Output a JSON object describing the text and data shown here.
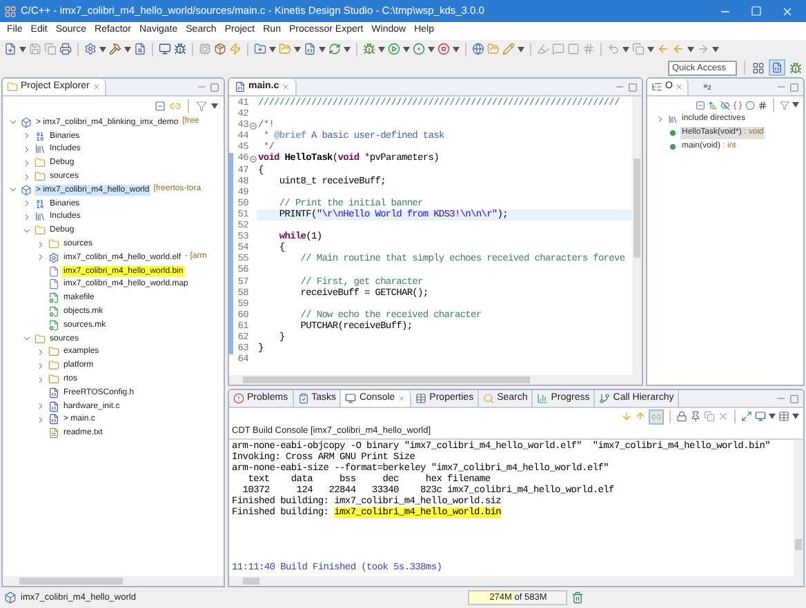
{
  "window": {
    "title": "C/C++ - imx7_colibri_m4_hello_world/sources/main.c - Kinetis Design Studio - C:\\tmp\\wsp_kds_3.0.0"
  },
  "menu": [
    "File",
    "Edit",
    "Source",
    "Refactor",
    "Navigate",
    "Search",
    "Project",
    "Run",
    "Processor Expert",
    "Window",
    "Help"
  ],
  "quick_access": {
    "placeholder": "Quick Access"
  },
  "project_explorer": {
    "title": "Project Explorer",
    "tree": [
      {
        "label": "> imx7_colibri_m4_blinking_imx_demo",
        "decoration": "[free",
        "kind": "project",
        "expanded": true,
        "selected": false,
        "marked": false,
        "children": [
          {
            "label": "Binaries",
            "kind": "binaries",
            "expanded": false,
            "selected": false,
            "marked": false
          },
          {
            "label": "Includes",
            "kind": "includes",
            "expanded": false,
            "selected": false,
            "marked": false
          },
          {
            "label": "Debug",
            "kind": "folder",
            "expanded": false,
            "selected": false,
            "marked": false
          },
          {
            "label": "sources",
            "kind": "source-folder",
            "expanded": false,
            "selected": false,
            "marked": false
          }
        ]
      },
      {
        "label": "> imx7_colibri_m4_hello_world",
        "decoration": "[freertos-tora",
        "kind": "project",
        "expanded": true,
        "selected": true,
        "marked": false,
        "children": [
          {
            "label": "Binaries",
            "kind": "binaries",
            "expanded": false,
            "selected": false,
            "marked": false
          },
          {
            "label": "Includes",
            "kind": "includes",
            "expanded": false,
            "selected": false,
            "marked": false
          },
          {
            "label": "Debug",
            "kind": "folder",
            "expanded": true,
            "selected": false,
            "marked": false,
            "children": [
              {
                "label": "sources",
                "kind": "folder",
                "expanded": false,
                "selected": false,
                "marked": false
              },
              {
                "label": "imx7_colibri_m4_hello_world.elf",
                "decoration": "- [arm",
                "kind": "elf",
                "expanded": false,
                "selected": false,
                "marked": false
              },
              {
                "label": "imx7_colibri_m4_hello_world.bin",
                "kind": "file",
                "selected": false,
                "marked": true
              },
              {
                "label": "imx7_colibri_m4_hello_world.map",
                "kind": "file",
                "selected": false,
                "marked": false
              },
              {
                "label": "makefile",
                "kind": "makefile",
                "selected": false,
                "marked": false
              },
              {
                "label": "objects.mk",
                "kind": "makefile",
                "selected": false,
                "marked": false
              },
              {
                "label": "sources.mk",
                "kind": "makefile",
                "selected": false,
                "marked": false
              }
            ]
          },
          {
            "label": "sources",
            "kind": "source-folder",
            "expanded": true,
            "selected": false,
            "marked": false,
            "children": [
              {
                "label": "examples",
                "kind": "source-folder",
                "expanded": false,
                "selected": false,
                "marked": false
              },
              {
                "label": "platform",
                "kind": "source-folder",
                "expanded": false,
                "selected": false,
                "marked": false
              },
              {
                "label": "rtos",
                "kind": "source-folder",
                "expanded": false,
                "selected": false,
                "marked": false
              },
              {
                "label": "FreeRTOSConfig.h",
                "kind": "header",
                "selected": false,
                "marked": false
              },
              {
                "label": "hardware_init.c",
                "kind": "c-file",
                "expanded": false,
                "selected": false,
                "marked": false
              },
              {
                "label": "> main.c",
                "kind": "c-file",
                "expanded": false,
                "selected": false,
                "marked": false
              },
              {
                "label": "readme.txt",
                "kind": "text-file",
                "selected": false,
                "marked": false
              }
            ]
          }
        ]
      }
    ]
  },
  "editor": {
    "tab": "main.c",
    "lines": [
      {
        "number": "41",
        "fold": false,
        "current": false,
        "in_range": false,
        "segments": [
          {
            "kind": "comment",
            "text": "////////////////////////////////////////////////////////////////////"
          }
        ]
      },
      {
        "number": "42",
        "fold": false,
        "current": false,
        "in_range": false
      },
      {
        "number": "43",
        "fold": true,
        "current": false,
        "in_range": false,
        "segments": [
          {
            "kind": "doc",
            "text": "/*!"
          }
        ]
      },
      {
        "number": "44",
        "fold": false,
        "current": false,
        "in_range": false,
        "segments": [
          {
            "kind": "doc",
            "text": " * "
          },
          {
            "kind": "doctag",
            "text": "@brief"
          },
          {
            "kind": "doc",
            "text": " A basic user-defined task"
          }
        ]
      },
      {
        "number": "45",
        "fold": false,
        "current": false,
        "in_range": false,
        "segments": [
          {
            "kind": "doc",
            "text": " */"
          }
        ]
      },
      {
        "number": "46",
        "fold": true,
        "current": false,
        "in_range": true,
        "segments": [
          {
            "kind": "keyword",
            "text": "void"
          },
          {
            "kind": "function",
            "text": " HelloTask"
          },
          {
            "kind": "plain",
            "text": "("
          },
          {
            "kind": "keyword",
            "text": "void"
          },
          {
            "kind": "plain",
            "text": " *pvParameters)"
          }
        ]
      },
      {
        "number": "47",
        "fold": false,
        "current": false,
        "in_range": true,
        "segments": [
          {
            "kind": "plain",
            "text": "{"
          }
        ]
      },
      {
        "number": "48",
        "fold": false,
        "current": false,
        "in_range": true,
        "segments": [
          {
            "kind": "plain",
            "text": "    uint8_t receiveBuff;"
          }
        ]
      },
      {
        "number": "49",
        "fold": false,
        "current": false,
        "in_range": true
      },
      {
        "number": "50",
        "fold": false,
        "current": false,
        "in_range": true,
        "segments": [
          {
            "kind": "comment",
            "text": "    // Print the initial banner"
          }
        ]
      },
      {
        "number": "51",
        "fold": false,
        "current": true,
        "in_range": true,
        "segments": [
          {
            "kind": "plain",
            "text": "    PRINTF("
          },
          {
            "kind": "string",
            "text": "\"\\r\\nHello World from KDS3!\\n\\n\\r\""
          },
          {
            "kind": "plain",
            "text": ");"
          }
        ]
      },
      {
        "number": "52",
        "fold": false,
        "current": false,
        "in_range": true
      },
      {
        "number": "53",
        "fold": false,
        "current": false,
        "in_range": true,
        "segments": [
          {
            "kind": "keyword",
            "text": "    while"
          },
          {
            "kind": "plain",
            "text": "(1)"
          }
        ]
      },
      {
        "number": "54",
        "fold": false,
        "current": false,
        "in_range": true,
        "segments": [
          {
            "kind": "plain",
            "text": "    {"
          }
        ]
      },
      {
        "number": "55",
        "fold": false,
        "current": false,
        "in_range": true,
        "segments": [
          {
            "kind": "comment",
            "text": "        // Main routine that simply echoes received characters foreve"
          }
        ]
      },
      {
        "number": "56",
        "fold": false,
        "current": false,
        "in_range": true
      },
      {
        "number": "57",
        "fold": false,
        "current": false,
        "in_range": true,
        "segments": [
          {
            "kind": "comment",
            "text": "        // First, get character"
          }
        ]
      },
      {
        "number": "58",
        "fold": false,
        "current": false,
        "in_range": true,
        "segments": [
          {
            "kind": "plain",
            "text": "        receiveBuff = GETCHAR();"
          }
        ]
      },
      {
        "number": "59",
        "fold": false,
        "current": false,
        "in_range": true
      },
      {
        "number": "60",
        "fold": false,
        "current": false,
        "in_range": true,
        "segments": [
          {
            "kind": "comment",
            "text": "        // Now echo the received character"
          }
        ]
      },
      {
        "number": "61",
        "fold": false,
        "current": false,
        "in_range": true,
        "segments": [
          {
            "kind": "plain",
            "text": "        PUTCHAR(receiveBuff);"
          }
        ]
      },
      {
        "number": "62",
        "fold": false,
        "current": false,
        "in_range": true,
        "segments": [
          {
            "kind": "plain",
            "text": "    }"
          }
        ]
      },
      {
        "number": "63",
        "fold": false,
        "current": false,
        "in_range": true,
        "segments": [
          {
            "kind": "plain",
            "text": "}"
          }
        ]
      },
      {
        "number": "64",
        "fold": false,
        "current": false,
        "in_range": false
      }
    ]
  },
  "outline": {
    "tab": "O",
    "overflow": "»$_{2}$",
    "items": [
      {
        "name": "include directives",
        "kind": "include",
        "expanded": false,
        "selected": false
      },
      {
        "name": "HelloTask(void*)",
        "type": " : void",
        "kind": "function",
        "selected": true
      },
      {
        "name": "main(void)",
        "type": " : int",
        "kind": "function",
        "selected": false
      }
    ]
  },
  "console": {
    "tabs": [
      {
        "label": "Problems",
        "selected": false
      },
      {
        "label": "Tasks",
        "selected": false
      },
      {
        "label": "Console",
        "selected": true
      },
      {
        "label": "Properties",
        "selected": false
      },
      {
        "label": "Search",
        "selected": false
      },
      {
        "label": "Progress",
        "selected": false
      },
      {
        "label": "Call Hierarchy",
        "selected": false
      }
    ],
    "title": "CDT Build Console [imx7_colibri_m4_hello_world]",
    "lines": [
      {
        "segments": [
          {
            "kind": "plain",
            "text": "arm-none-eabi-objcopy -O binary \"imx7_colibri_m4_hello_world.elf\"  \"imx7_colibri_m4_hello_world.bin\""
          }
        ]
      },
      {
        "segments": [
          {
            "kind": "plain",
            "text": "Invoking: Cross ARM GNU Print Size"
          }
        ]
      },
      {
        "segments": [
          {
            "kind": "plain",
            "text": "arm-none-eabi-size --format=berkeley \"imx7_colibri_m4_hello_world.elf\""
          }
        ]
      },
      {
        "segments": [
          {
            "kind": "plain",
            "text": "   text    data     bss     dec     hex filename"
          }
        ]
      },
      {
        "segments": [
          {
            "kind": "plain",
            "text": "  10372     124   22844   33340    823c imx7_colibri_m4_hello_world.elf"
          }
        ]
      },
      {
        "segments": [
          {
            "kind": "plain",
            "text": "Finished building: imx7_colibri_m4_hello_world.siz"
          }
        ]
      },
      {
        "segments": [
          {
            "kind": "plain",
            "text": "Finished building: "
          },
          {
            "kind": "highlight",
            "text": "imx7_colibri_m4_hello_world.bin"
          }
        ]
      }
    ],
    "result": {
      "segments": [
        {
          "kind": "info",
          "text": "11:11:40 Build Finished (took 5s.338ms)"
        }
      ]
    }
  },
  "status_bar": {
    "project": "imx7_colibri_m4_hello_world",
    "heap": {
      "text": "274M of 583M",
      "level": 0.47
    }
  }
}
